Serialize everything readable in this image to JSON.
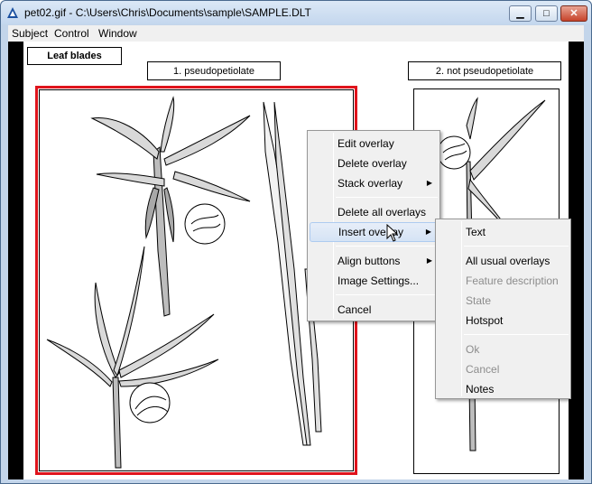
{
  "window": {
    "title": "pet02.gif - C:\\Users\\Chris\\Documents\\sample\\SAMPLE.DLT",
    "minimize_glyph": "▁",
    "maximize_glyph": "□",
    "close_glyph": "✕"
  },
  "menubar": {
    "items": [
      "Subject",
      "Control",
      "Window"
    ]
  },
  "page": {
    "heading": "Leaf blades",
    "caption_left": "1. pseudopetiolate",
    "caption_right": "2. not pseudopetiolate"
  },
  "context_menu": {
    "items": [
      {
        "label": "Edit overlay"
      },
      {
        "label": "Delete overlay"
      },
      {
        "label": "Stack overlay",
        "submenu": true
      },
      {
        "label": "Delete all overlays"
      },
      {
        "label": "Insert overlay",
        "submenu": true,
        "highlighted": true
      },
      {
        "label": "Align buttons",
        "submenu": true
      },
      {
        "label": "Image Settings..."
      },
      {
        "label": "Cancel"
      }
    ],
    "arrow_glyph": "▶"
  },
  "submenu": {
    "items": [
      {
        "label": "Text",
        "enabled": true
      },
      {
        "label": "All usual overlays",
        "enabled": true
      },
      {
        "label": "Feature description",
        "enabled": false
      },
      {
        "label": "State",
        "enabled": false
      },
      {
        "label": "Hotspot",
        "enabled": true
      },
      {
        "label": "Ok",
        "enabled": false
      },
      {
        "label": "Cancel",
        "enabled": false
      },
      {
        "label": "Notes",
        "enabled": true
      }
    ]
  },
  "colors": {
    "selection_frame": "#e0141c",
    "titlebar": "#c4d7ee",
    "menu_bg": "#f0f0f0",
    "disabled_text": "#8d8d8d"
  }
}
